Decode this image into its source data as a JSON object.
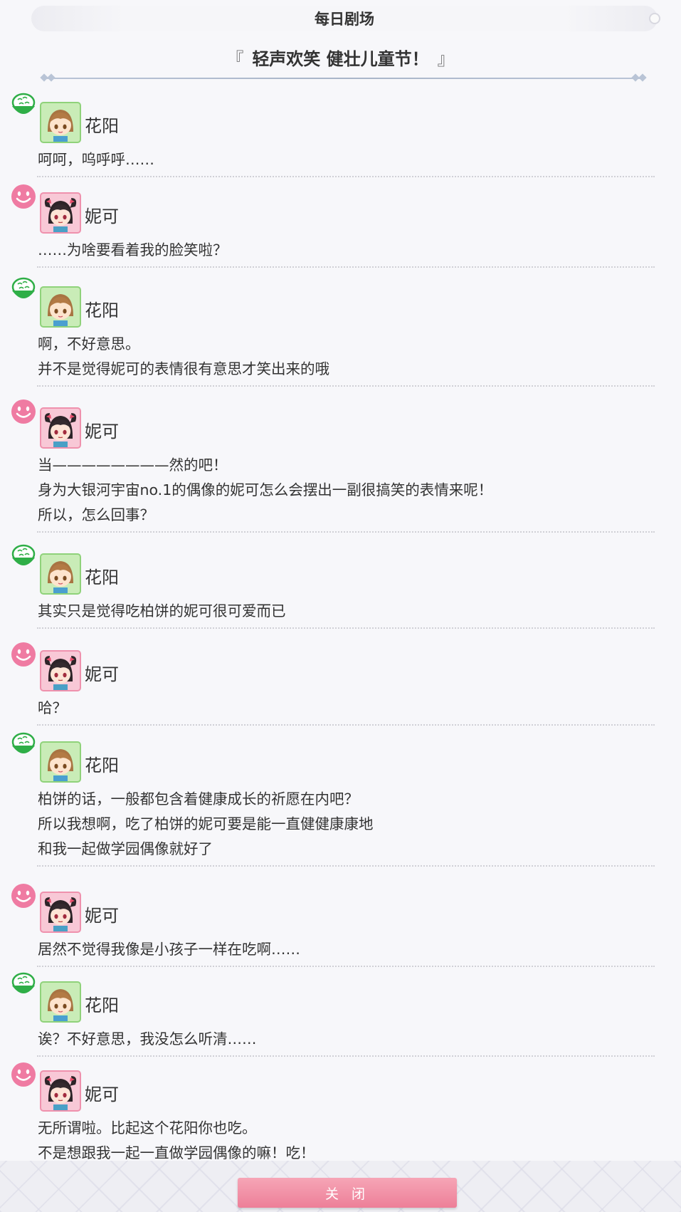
{
  "header": {
    "title": "每日剧场"
  },
  "episode": {
    "open_mark": "『",
    "title": "轻声欢笑 健壮儿童节！",
    "close_mark": "』"
  },
  "speakers": {
    "hanayo": {
      "name": "花阳",
      "icon": "rice-bowl-icon",
      "color": "#3cb84a"
    },
    "nico": {
      "name": "妮可",
      "icon": "smiley-face-icon",
      "color": "#ee6f9a"
    }
  },
  "dialogue": [
    {
      "speaker": "hanayo",
      "name": "花阳",
      "lines": [
        "呵呵，呜呼呼……"
      ]
    },
    {
      "speaker": "nico",
      "name": "妮可",
      "lines": [
        "……为啥要看着我的脸笑啦？"
      ]
    },
    {
      "speaker": "hanayo",
      "name": "花阳",
      "lines": [
        "啊，不好意思。",
        "并不是觉得妮可的表情很有意思才笑出来的哦"
      ]
    },
    {
      "speaker": "nico",
      "name": "妮可",
      "lines": [
        "当————————然的吧！",
        "身为大银河宇宙no.1的偶像的妮可怎么会摆出一副很搞笑的表情来呢！",
        "所以，怎么回事？"
      ]
    },
    {
      "speaker": "hanayo",
      "name": "花阳",
      "lines": [
        "其实只是觉得吃柏饼的妮可很可爱而已"
      ]
    },
    {
      "speaker": "nico",
      "name": "妮可",
      "lines": [
        "哈？"
      ]
    },
    {
      "speaker": "hanayo",
      "name": "花阳",
      "lines": [
        "柏饼的话，一般都包含着健康成长的祈愿在内吧？",
        "所以我想啊，吃了柏饼的妮可要是能一直健健康康地",
        "和我一起做学园偶像就好了"
      ]
    },
    {
      "speaker": "nico",
      "name": "妮可",
      "lines": [
        "居然不觉得我像是小孩子一样在吃啊……"
      ]
    },
    {
      "speaker": "hanayo",
      "name": "花阳",
      "lines": [
        "诶？不好意思，我没怎么听清……"
      ]
    },
    {
      "speaker": "nico",
      "name": "妮可",
      "lines": [
        "无所谓啦。比起这个花阳你也吃。",
        "不是想跟我一起一直做学园偶像的嘛！吃！"
      ]
    }
  ],
  "footer": {
    "close_label": "关 闭"
  }
}
